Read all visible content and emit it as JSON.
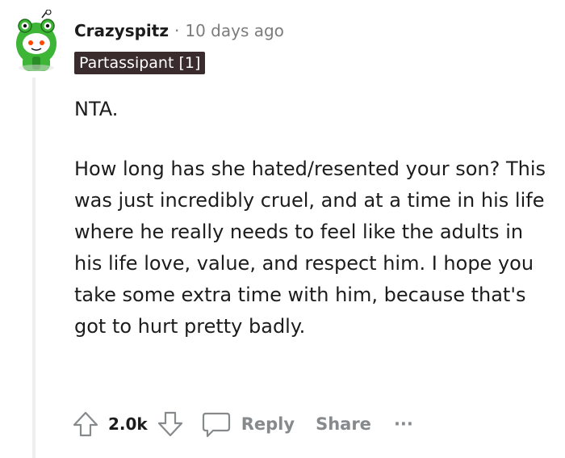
{
  "comment": {
    "username": "Crazyspitz",
    "separator": "·",
    "timestamp": "10 days ago",
    "flair": "Partassipant [1]",
    "paragraphs": [
      "NTA.",
      "How long has she hated/resented your son? This was just incredibly cruel, and at a time in his life where he really needs to feel like the adults in his life love, value, and respect him. I hope you take some extra time with him, because that's got to hurt pretty badly."
    ],
    "votes": "2.0k",
    "actions": {
      "reply_label": "Reply",
      "share_label": "Share",
      "more_label": "···"
    }
  },
  "colors": {
    "flair_bg": "#3a2c2c",
    "meta_gray": "#7c7c7c",
    "action_gray": "#878a8c",
    "thread_line": "#edeff1",
    "avatar_green": "#3db536"
  },
  "icons": {
    "avatar": "snoo-frog-hat-avatar",
    "upvote": "arrow-up-icon",
    "downvote": "arrow-down-icon",
    "reply": "speech-bubble-icon"
  }
}
